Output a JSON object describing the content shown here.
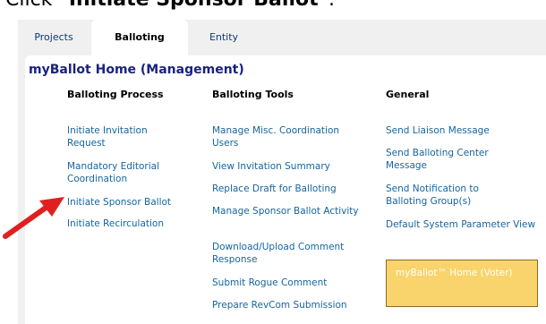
{
  "caption": {
    "prefix": "Click “",
    "strong": "Initiate Sponsor Ballot",
    "suffix": "”."
  },
  "tabs": [
    {
      "label": "Projects",
      "active": false
    },
    {
      "label": "Balloting",
      "active": true
    },
    {
      "label": "Entity",
      "active": false
    }
  ],
  "home_title": "myBallot Home (Management)",
  "columns": [
    {
      "heading": "Balloting Process",
      "links": [
        "Initiate Invitation Request",
        "Mandatory Editorial Coordination",
        "Initiate Sponsor Ballot",
        "Initiate Recirculation"
      ]
    },
    {
      "heading": "Balloting Tools",
      "links": [
        "Manage Misc. Coordination Users",
        "View Invitation Summary",
        "Replace Draft for Balloting",
        "Manage Sponsor Ballot Activity",
        "Download/Upload Comment Response",
        "Submit Rogue Comment",
        "Prepare RevCom Submission"
      ]
    },
    {
      "heading": "General",
      "links": [
        "Send Liaison Message",
        "Send Balloting Center Message",
        "Send Notification to Balloting Group(s)",
        "Default System Parameter View"
      ]
    }
  ],
  "voter_link": "myBallot™ Home (Voter)",
  "colors": {
    "tab_text": "#0b3a7a",
    "title": "#1a237e",
    "link": "#1565a0",
    "voter_box": "#f9d36b",
    "arrow": "#e02020"
  },
  "icons": {
    "pointer": "red-arrow-icon"
  }
}
